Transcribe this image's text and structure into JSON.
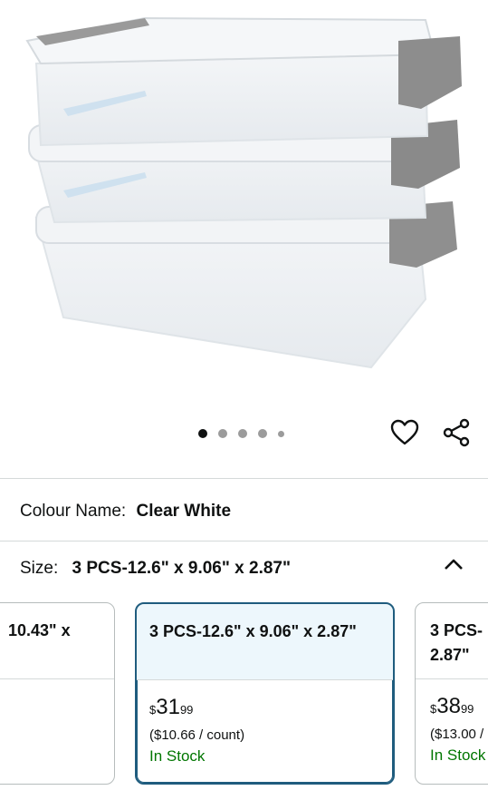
{
  "product": {
    "image_icon": "storage-box-image",
    "carousel": {
      "count": 5,
      "active": 0
    },
    "heart_icon": "heart-icon",
    "share_icon": "share-icon"
  },
  "colour": {
    "label": "Colour Name:",
    "value": "Clear White"
  },
  "size": {
    "label": "Size:",
    "value": "3 PCS-12.6\" x 9.06\" x 2.87\"",
    "chevron": "chevron-up-icon"
  },
  "options": [
    {
      "title": "10.43\" x",
      "currency": "",
      "whole": "",
      "cents": "",
      "per": "",
      "stock": ""
    },
    {
      "title": "3 PCS-12.6\" x 9.06\" x 2.87\"",
      "currency": "$",
      "whole": "31",
      "cents": "99",
      "per": "($10.66 / count)",
      "stock": "In Stock"
    },
    {
      "title": "3 PCS-     2.87\"",
      "currency": "$",
      "whole": "38",
      "cents": "99",
      "per": "($13.00 /",
      "stock": "In Stock"
    }
  ],
  "colors": {
    "selected_border": "#1f5c7e",
    "selected_bg": "#edf7fc",
    "in_stock": "#007600"
  }
}
